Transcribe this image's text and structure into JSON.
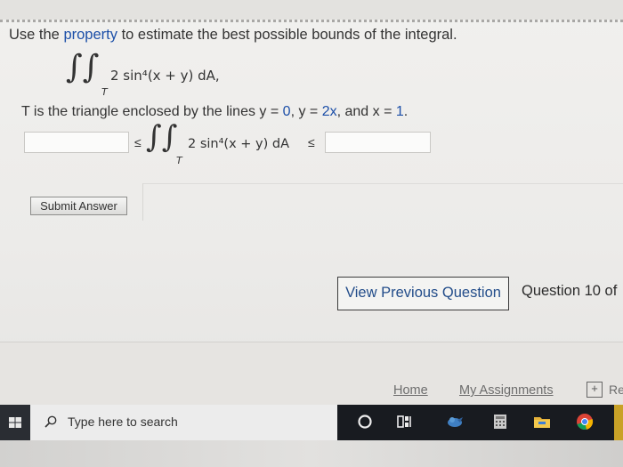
{
  "question": {
    "prompt_before_link": "Use the ",
    "prompt_link": "property",
    "prompt_after_link": " to estimate the best possible bounds of the integral.",
    "integral_subscript": "T",
    "integrand": "2 sin⁴(x + y) dA,",
    "condition_prefix": "T is the triangle enclosed by the lines y = ",
    "condition_v1": "0",
    "condition_mid1": ", y = ",
    "condition_v2": "2x",
    "condition_mid2": ", and x = ",
    "condition_v3": "1",
    "condition_end": "."
  },
  "answer": {
    "lower_value": "",
    "upper_value": "",
    "leq_symbol": "≤",
    "integrand": "2 sin⁴(x + y) dA",
    "integral_subscript": "T"
  },
  "buttons": {
    "submit": "Submit Answer",
    "previous": "View Previous Question",
    "question_counter": "Question 10 of"
  },
  "footer": {
    "home": "Home",
    "assignments": "My Assignments",
    "more_icon": "plus-box-icon",
    "more_text": "Re"
  },
  "taskbar": {
    "search_placeholder": "Type here to search",
    "icons": [
      "windows-icon",
      "cortana-circle-icon",
      "task-view-icon",
      "bird-app-icon",
      "calculator-icon",
      "file-explorer-icon",
      "chrome-icon"
    ]
  },
  "colors": {
    "link": "#1c4fa8",
    "taskbar": "#181b20",
    "page_bg": "#f1f0ee"
  }
}
